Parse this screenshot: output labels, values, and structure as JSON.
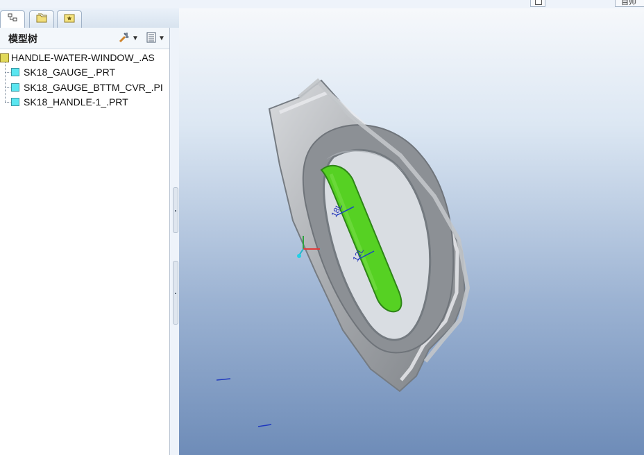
{
  "window": {
    "title": "",
    "top_right_label": "自帅"
  },
  "tabs": [
    {
      "name": "model-tree",
      "icon": "tree-icon"
    },
    {
      "name": "folder-browser",
      "icon": "folders-icon"
    },
    {
      "name": "favorites",
      "icon": "star-icon"
    }
  ],
  "panel": {
    "title": "模型树",
    "settings_icon": "tools-icon",
    "show_icon": "list-icon"
  },
  "tree": {
    "root": {
      "label": "HANDLE-WATER-WINDOW_.AS",
      "icon": "assembly-icon"
    },
    "items": [
      {
        "label": "SK18_GAUGE_.PRT",
        "icon": "part-icon"
      },
      {
        "label": "SK18_GAUGE_BTTM_CVR_.PI",
        "icon": "part-icon"
      },
      {
        "label": "SK18_HANDLE-1_.PRT",
        "icon": "part-icon"
      }
    ]
  },
  "viewport": {
    "model_label_1": "18L",
    "model_label_2": "12L",
    "colors": {
      "gray": "#a6a9ad",
      "window": "#56d123",
      "bg_top": "#f6f8fb",
      "bg_bottom": "#6e8cb8"
    }
  }
}
